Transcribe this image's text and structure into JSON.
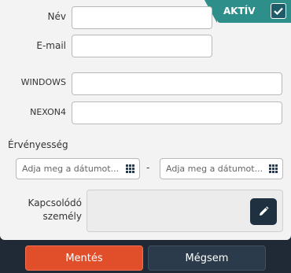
{
  "form": {
    "name_label": "Név",
    "email_label": "E-mail",
    "windows_label": "WINDOWS",
    "nexon_label": "NEXON4",
    "validity_label": "Érvényesség",
    "date_from_placeholder": "Adja meg a dátumot...",
    "date_separator": "-",
    "date_to_placeholder": "Adja meg a dátumot...",
    "contact_label_line1": "Kapcsolódó",
    "contact_label_line2": "személy"
  },
  "status": {
    "active_label": "AKTÍV",
    "active_checked": true
  },
  "footer": {
    "save_label": "Mentés",
    "cancel_label": "Mégsem"
  },
  "colors": {
    "active_badge": "#2e8e8a",
    "save_button": "#e04e2a",
    "cancel_button": "#2c3b4b",
    "background": "#1f2a36"
  },
  "icons": [
    "check-icon",
    "calendar-icon",
    "calendar-icon",
    "pencil-icon"
  ]
}
